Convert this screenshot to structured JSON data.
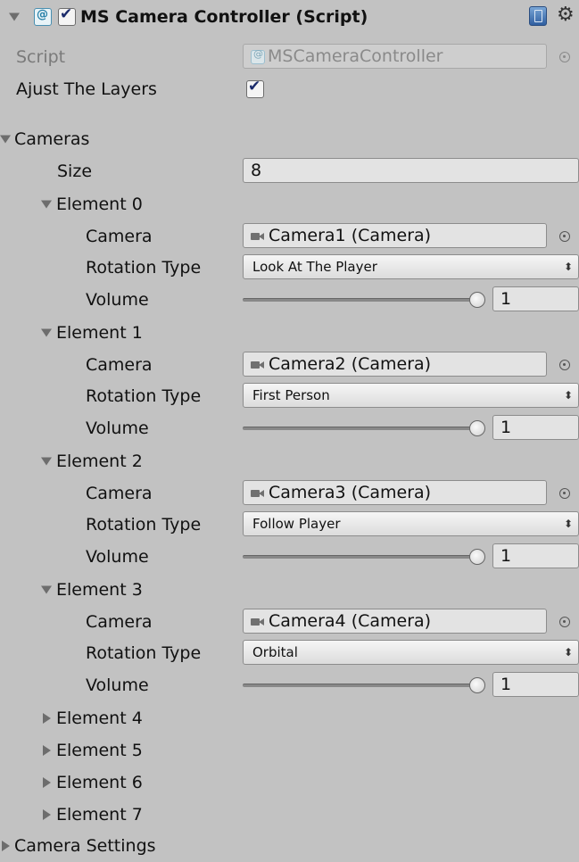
{
  "component": {
    "title": "MS Camera Controller (Script)",
    "enabled": true,
    "icons": [
      "foldout-open-icon",
      "script-icon",
      "checkbox-icon",
      "help-book-icon",
      "gear-icon"
    ]
  },
  "script_field": {
    "label": "Script",
    "value": "MSCameraController"
  },
  "ajust_layers": {
    "label": "Ajust The Layers",
    "checked": true
  },
  "cameras": {
    "label": "Cameras",
    "size_label": "Size",
    "size_value": "8",
    "elements": [
      {
        "label": "Element 0",
        "camera_label": "Camera",
        "camera_value": "Camera1 (Camera)",
        "rotation_label": "Rotation Type",
        "rotation_value": "Look At The Player",
        "volume_label": "Volume",
        "volume_value": "1"
      },
      {
        "label": "Element 1",
        "camera_label": "Camera",
        "camera_value": "Camera2 (Camera)",
        "rotation_label": "Rotation Type",
        "rotation_value": "First Person",
        "volume_label": "Volume",
        "volume_value": "1"
      },
      {
        "label": "Element 2",
        "camera_label": "Camera",
        "camera_value": "Camera3 (Camera)",
        "rotation_label": "Rotation Type",
        "rotation_value": "Follow Player",
        "volume_label": "Volume",
        "volume_value": "1"
      },
      {
        "label": "Element 3",
        "camera_label": "Camera",
        "camera_value": "Camera4 (Camera)",
        "rotation_label": "Rotation Type",
        "rotation_value": "Orbital",
        "volume_label": "Volume",
        "volume_value": "1"
      }
    ],
    "collapsed": [
      "Element 4",
      "Element 5",
      "Element 6",
      "Element 7"
    ]
  },
  "camera_settings": {
    "label": "Camera Settings"
  },
  "colors": {
    "background": "#c2c2c2",
    "field": "#e3e3e3",
    "checkmark": "#1a2a6a"
  }
}
